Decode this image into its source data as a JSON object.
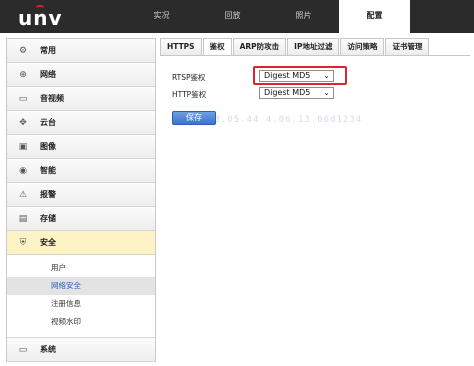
{
  "brand": {
    "logo_text": "unv"
  },
  "nav": {
    "items": [
      {
        "label": "实况"
      },
      {
        "label": "回放"
      },
      {
        "label": "照片"
      },
      {
        "label": "配置",
        "active": true
      }
    ]
  },
  "sidebar": {
    "items": [
      {
        "label": "常用",
        "icon": "settings-icon"
      },
      {
        "label": "网络",
        "icon": "network-icon"
      },
      {
        "label": "音视频",
        "icon": "video-icon"
      },
      {
        "label": "云台",
        "icon": "ptz-icon"
      },
      {
        "label": "图像",
        "icon": "image-icon"
      },
      {
        "label": "智能",
        "icon": "intelligence-icon"
      },
      {
        "label": "报警",
        "icon": "alarm-icon"
      },
      {
        "label": "存储",
        "icon": "storage-icon"
      },
      {
        "label": "安全",
        "icon": "shield-icon",
        "active": true
      },
      {
        "label": "系统",
        "icon": "system-icon"
      }
    ],
    "security_submenu": [
      {
        "label": "用户"
      },
      {
        "label": "网络安全",
        "active": true
      },
      {
        "label": "注册信息"
      },
      {
        "label": "视频水印"
      }
    ]
  },
  "tabs": [
    {
      "label": "HTTPS"
    },
    {
      "label": "鉴权",
      "active": true
    },
    {
      "label": "ARP防攻击"
    },
    {
      "label": "IP地址过滤"
    },
    {
      "label": "访问策略"
    },
    {
      "label": "证书管理"
    }
  ],
  "form": {
    "rtsp_label": "RTSP鉴权",
    "rtsp_value": "Digest MD5",
    "http_label": "HTTP鉴权",
    "http_value": "Digest MD5",
    "save_label": "保存"
  },
  "watermark": {
    "text": "2 29.00.05.44  4.06.13.06d1234"
  },
  "colors": {
    "topbar": "#2b2b2b",
    "highlight": "#d9272e",
    "active_sidebar": "#fdf3c5",
    "active_link": "#2860b8",
    "button": "#3c74cf"
  }
}
